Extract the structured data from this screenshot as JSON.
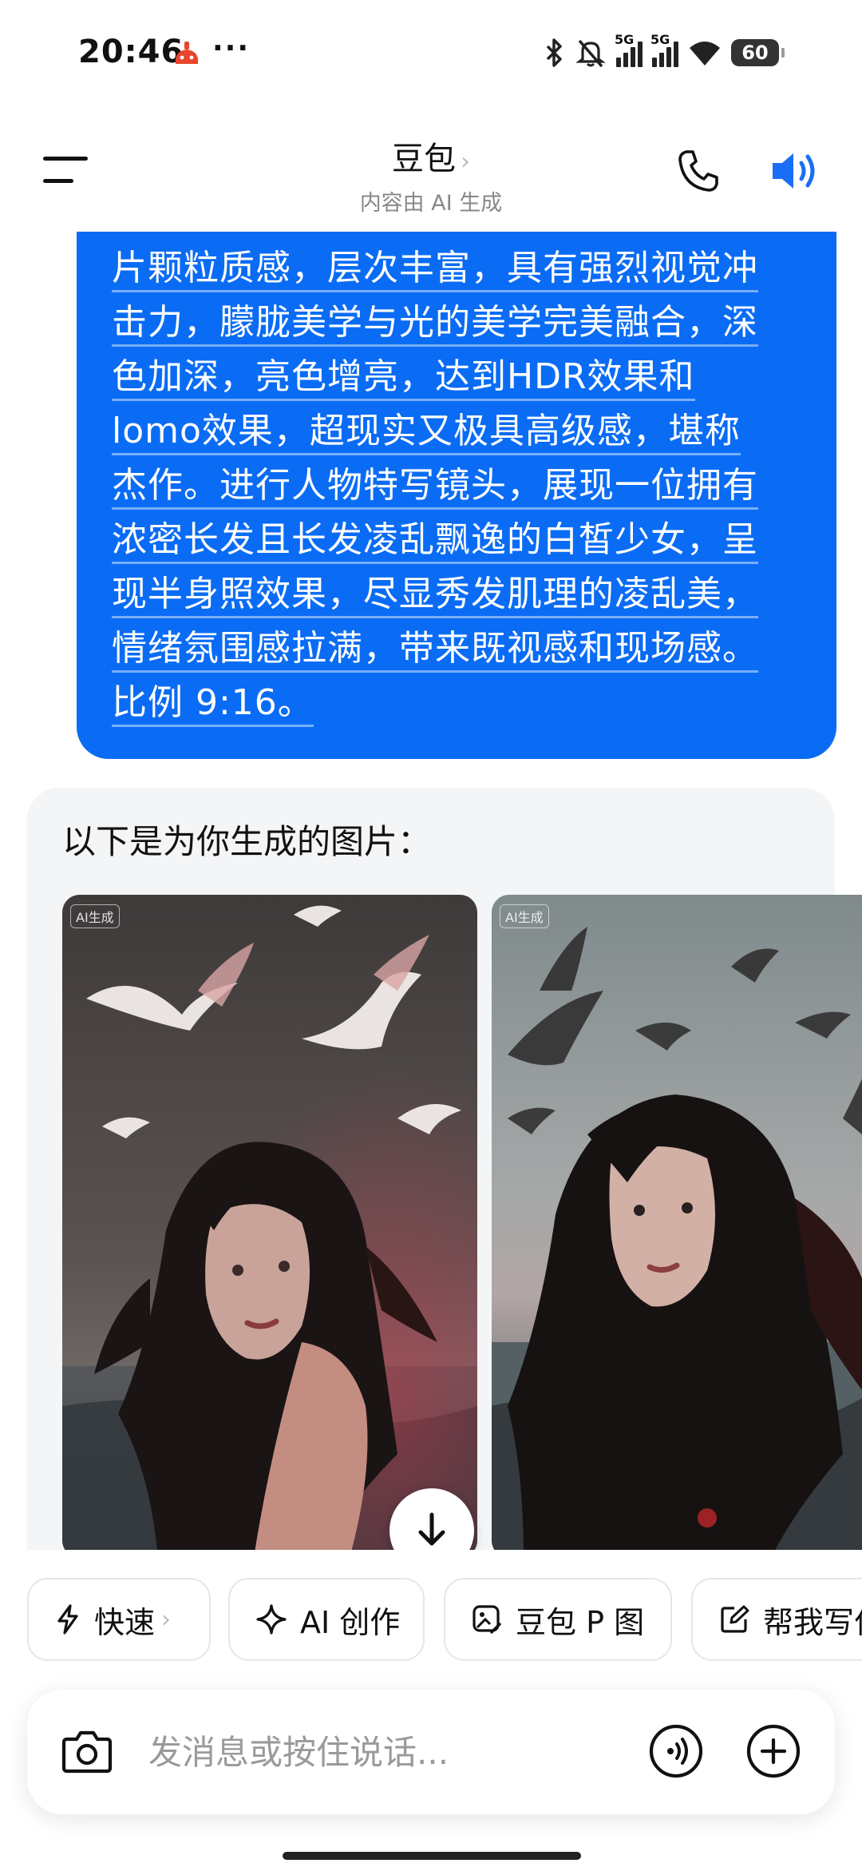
{
  "status_bar": {
    "time": "20:46",
    "more": "···",
    "network_1": "5G",
    "network_2": "5G",
    "battery": "60"
  },
  "header": {
    "title": "豆包",
    "subtitle": "内容由 AI 生成"
  },
  "user_message": {
    "lines": [
      "片颗粒质感，层次丰富，具有强烈视觉冲",
      "击力，朦胧美学与光的美学完美融合，深",
      "色加深，亮色增亮，达到HDR效果和",
      "lomo效果，超现实又极具高级感，堪称",
      "杰作。进行人物特写镜头，展现一位拥有",
      "浓密长发且长发凌乱飘逸的白皙少女，呈",
      "现半身照效果，尽显秀发肌理的凌乱美，",
      "情绪氛围感拉满，带来既视感和现场感。",
      "比例 9:16。"
    ]
  },
  "bot_message": {
    "text": "以下是为你生成的图片：",
    "images": [
      {
        "tag": "AI生成"
      },
      {
        "tag": "AI生成"
      }
    ]
  },
  "quick_actions": [
    {
      "label": "快速",
      "icon": "lightning-icon"
    },
    {
      "label": "AI 创作",
      "icon": "sparkle-icon"
    },
    {
      "label": "豆包 P 图",
      "icon": "image-edit-icon"
    },
    {
      "label": "帮我写作",
      "icon": "write-icon"
    }
  ],
  "input": {
    "placeholder": "发消息或按住说话..."
  },
  "colors": {
    "accent": "#0a6cf5",
    "user_bubble": "#0a6cf5",
    "bot_bubble": "#f4f5f7"
  }
}
